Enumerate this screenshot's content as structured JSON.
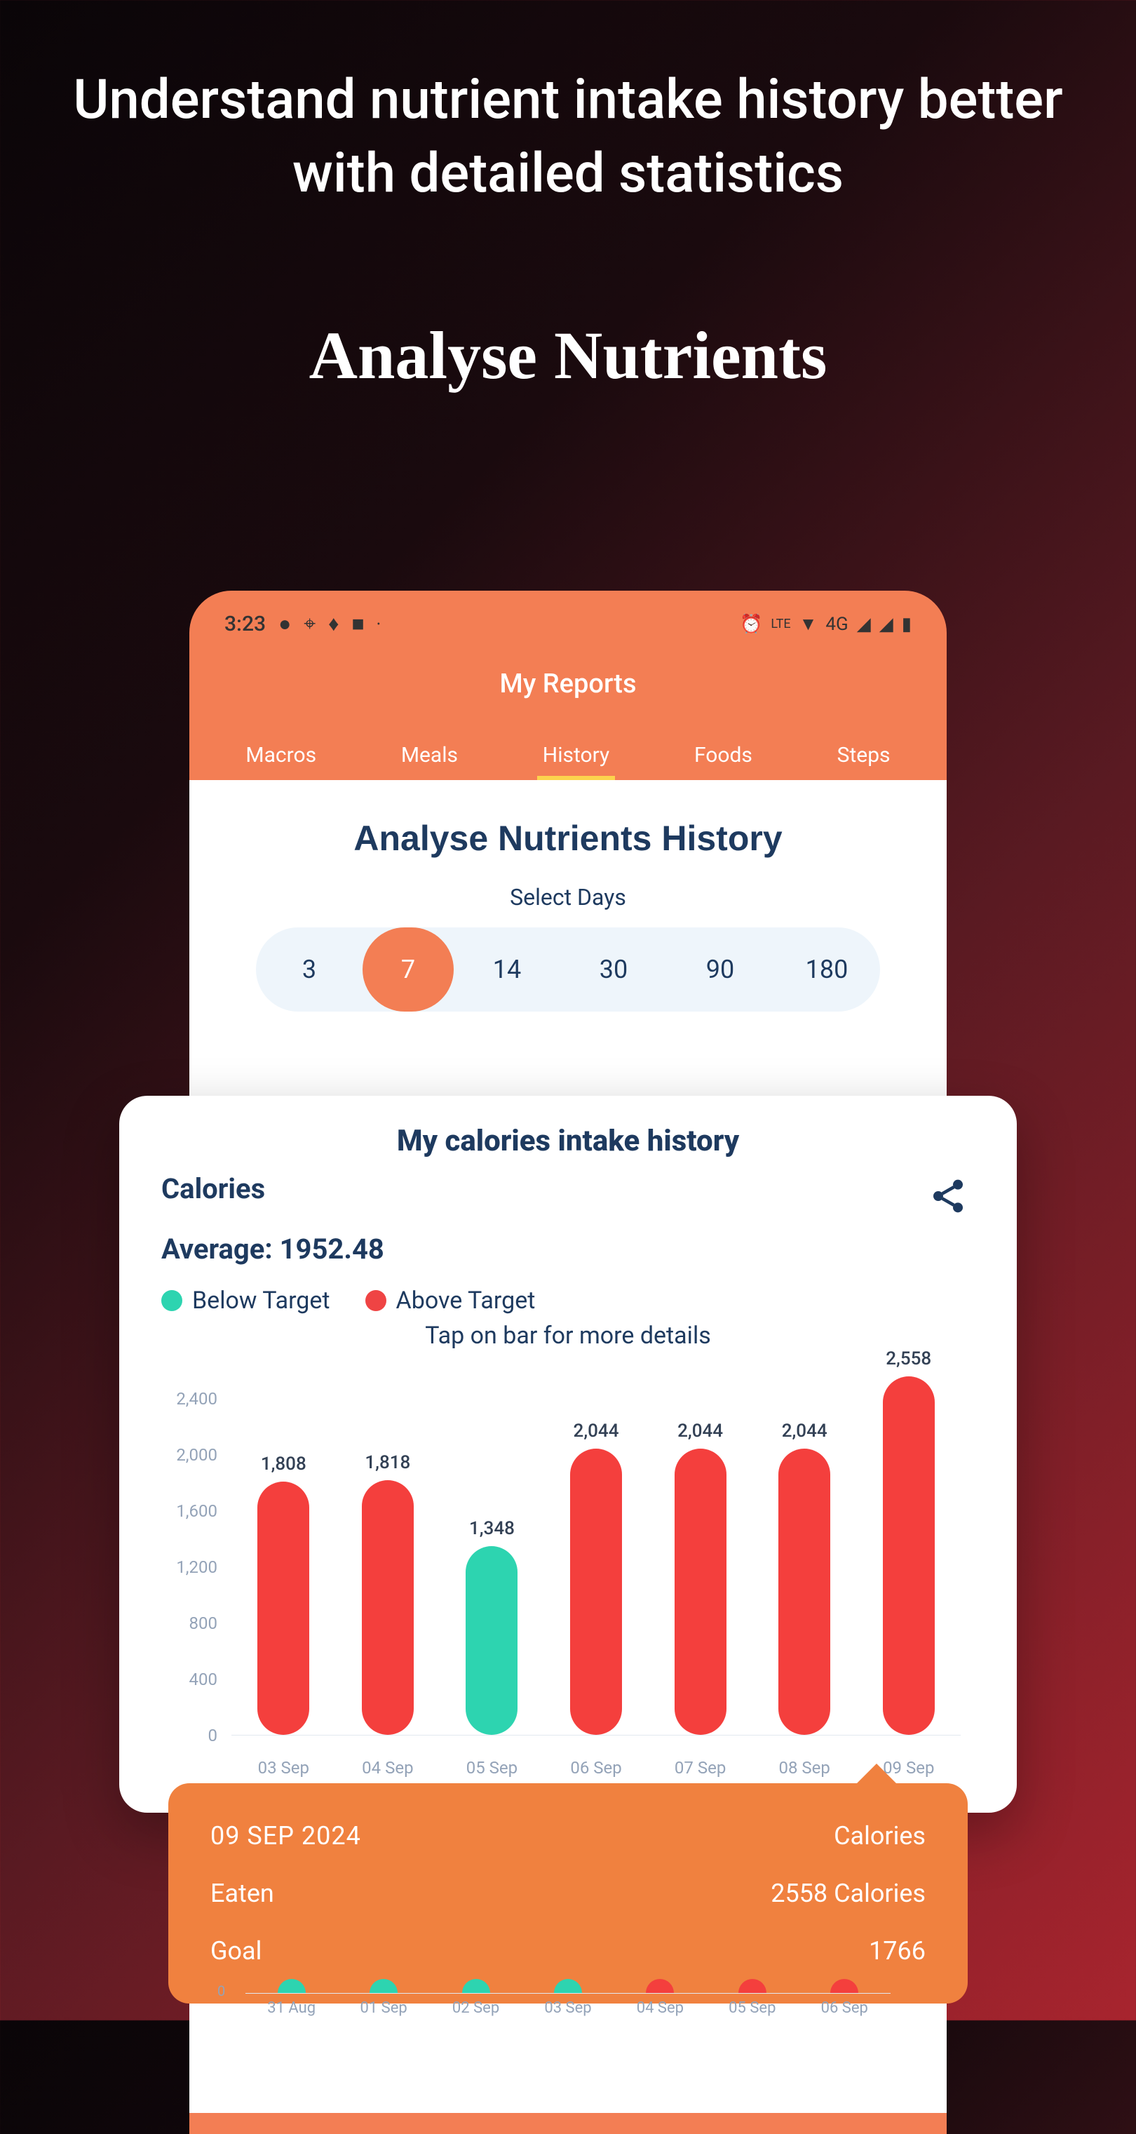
{
  "headline": "Understand nutrient intake history better with detailed statistics",
  "subheadline": "Analyse Nutrients",
  "status": {
    "time": "3:23",
    "network": "4G",
    "lte": "LTE"
  },
  "app_title": "My Reports",
  "tabs": [
    {
      "label": "Macros",
      "active": false
    },
    {
      "label": "Meals",
      "active": false
    },
    {
      "label": "History",
      "active": true
    },
    {
      "label": "Foods",
      "active": false
    },
    {
      "label": "Steps",
      "active": false
    }
  ],
  "section_title": "Analyse Nutrients History",
  "select_days_label": "Select Days",
  "day_options": [
    {
      "label": "3",
      "active": false
    },
    {
      "label": "7",
      "active": true
    },
    {
      "label": "14",
      "active": false
    },
    {
      "label": "30",
      "active": false
    },
    {
      "label": "90",
      "active": false
    },
    {
      "label": "180",
      "active": false
    }
  ],
  "chart": {
    "title": "My calories intake history",
    "metric_label": "Calories",
    "average_label": "Average: 1952.48",
    "legend_below": "Below Target",
    "legend_above": "Above Target",
    "tap_hint": "Tap on bar for more details"
  },
  "chart_data": {
    "type": "bar",
    "categories": [
      "03 Sep",
      "04 Sep",
      "05 Sep",
      "06 Sep",
      "07 Sep",
      "08 Sep",
      "09 Sep"
    ],
    "values": [
      1808,
      1818,
      1348,
      2044,
      2044,
      2044,
      2558
    ],
    "value_labels": [
      "1,808",
      "1,818",
      "1,348",
      "2,044",
      "2,044",
      "2,044",
      "2,558"
    ],
    "status": [
      "above",
      "above",
      "below",
      "above",
      "above",
      "above",
      "above"
    ],
    "ylim": [
      0,
      2600
    ],
    "yticks": [
      0,
      400,
      800,
      1200,
      1600,
      2000,
      2400
    ],
    "ytick_labels": [
      "0",
      "400",
      "800",
      "1,200",
      "1,600",
      "2,000",
      "2,400"
    ],
    "colors": {
      "above": "#f43f3d",
      "below": "#2dd4b0"
    }
  },
  "tooltip": {
    "date": "09 SEP 2024",
    "metric": "Calories",
    "eaten_label": "Eaten",
    "eaten_value": "2558 Calories",
    "goal_label": "Goal",
    "goal_value": "1766"
  },
  "mini_chart": {
    "categories": [
      "31 Aug",
      "01 Sep",
      "02 Sep",
      "03 Sep",
      "04 Sep",
      "05 Sep",
      "06 Sep"
    ],
    "status": [
      "below",
      "below",
      "below",
      "below",
      "above",
      "above",
      "above"
    ],
    "y_label": "0"
  }
}
